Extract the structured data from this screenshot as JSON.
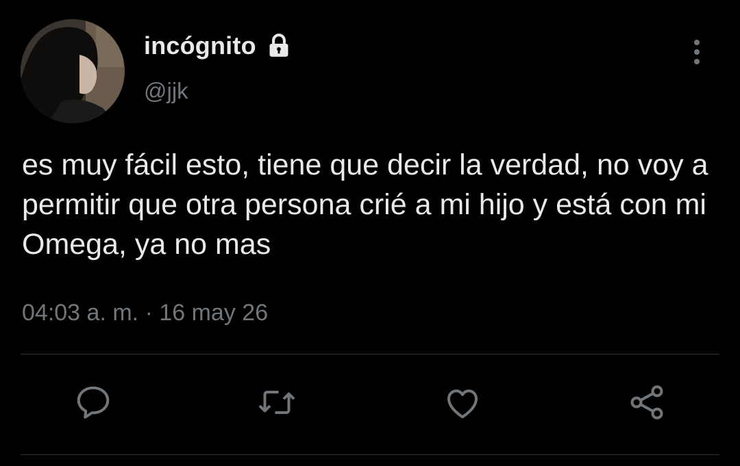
{
  "user": {
    "display_name": "incógnito",
    "handle": "@jjk",
    "locked_icon": "lock-icon"
  },
  "tweet": {
    "text": "es muy fácil esto, tiene que decir la verdad, no voy a permitir que otra persona crié a mi hijo y está con mi Omega, ya no mas",
    "time": "04:03 a. m.",
    "separator": "·",
    "date": "16 may 26"
  },
  "actions": [
    {
      "icon": "reply-icon"
    },
    {
      "icon": "retweet-icon"
    },
    {
      "icon": "like-icon"
    },
    {
      "icon": "share-icon"
    }
  ],
  "colors": {
    "background": "#000000",
    "primary_text": "#e7e9ea",
    "secondary_text": "#71767b",
    "divider": "#2f3336"
  }
}
